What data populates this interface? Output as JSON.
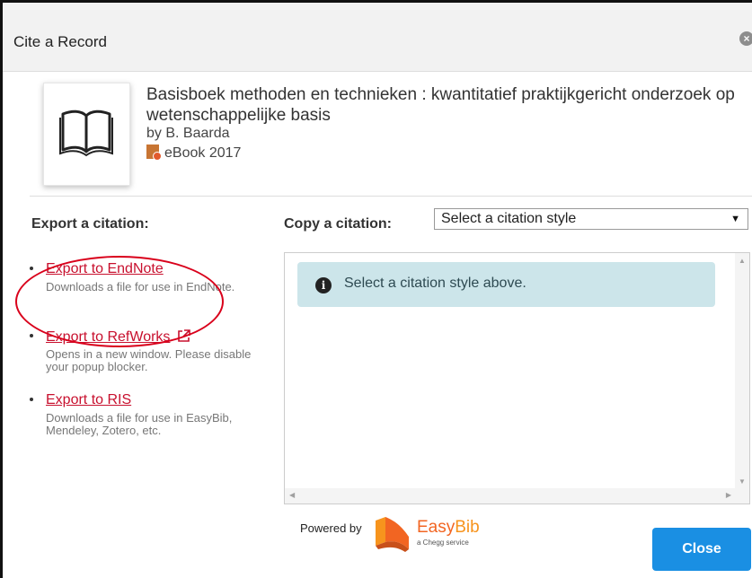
{
  "dialog": {
    "title": "Cite a Record",
    "close_icon": "close-circle-icon"
  },
  "record": {
    "title": "Basisboek methoden en technieken : kwantitatief praktijkgericht onderzoek op wetenschappelijke basis",
    "author": "by B. Baarda",
    "format": "eBook 2017",
    "thumbnail_icon": "open-book-icon",
    "format_icon": "ebook-icon"
  },
  "export": {
    "heading": "Export a citation:",
    "items": [
      {
        "label": "Export to EndNote",
        "description": "Downloads a file for use in EndNote."
      },
      {
        "label": "Export to RefWorks",
        "description": "Opens in a new window. Please disable your popup blocker.",
        "icon": "external-link-icon"
      },
      {
        "label": "Export to RIS",
        "description": "Downloads a file for use in EasyBib, Mendeley, Zotero, etc."
      }
    ]
  },
  "copy": {
    "heading": "Copy a citation:",
    "select_value": "Select a citation style",
    "message": "Select a citation style above.",
    "message_icon": "info-icon"
  },
  "footer": {
    "powered_by": "Powered by",
    "brand_easy": "Easy",
    "brand_bib": "Bib",
    "brand_sub": "a Chegg service",
    "close_label": "Close"
  },
  "colors": {
    "link": "#c8102e",
    "info_bg": "#cce5ea",
    "button": "#1a8fe3",
    "highlight": "#d9001b",
    "brand": "#f26522"
  }
}
